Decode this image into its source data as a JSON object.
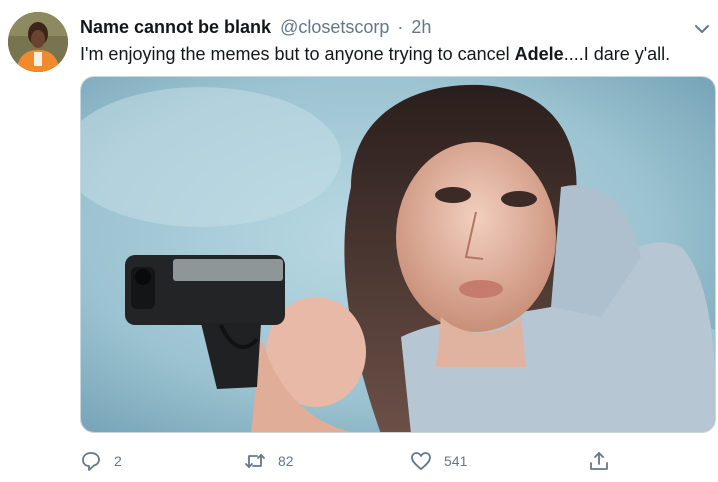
{
  "tweet": {
    "display_name": "Name cannot be blank",
    "handle": "@closetscorp",
    "separator": "·",
    "time": "2h",
    "text_before": "I'm enjoying the memes but to anyone trying to cancel ",
    "text_bold": "Adele",
    "text_after": "....I dare y'all."
  },
  "actions": {
    "reply_count": "2",
    "retweet_count": "82",
    "like_count": "541"
  },
  "icons": {
    "more": "chevron-down-icon",
    "reply": "reply-icon",
    "retweet": "retweet-icon",
    "like": "heart-icon",
    "share": "share-icon"
  },
  "colors": {
    "secondary_text": "#657786",
    "primary_text": "#14171a",
    "image_background": "#9fc6d3"
  }
}
